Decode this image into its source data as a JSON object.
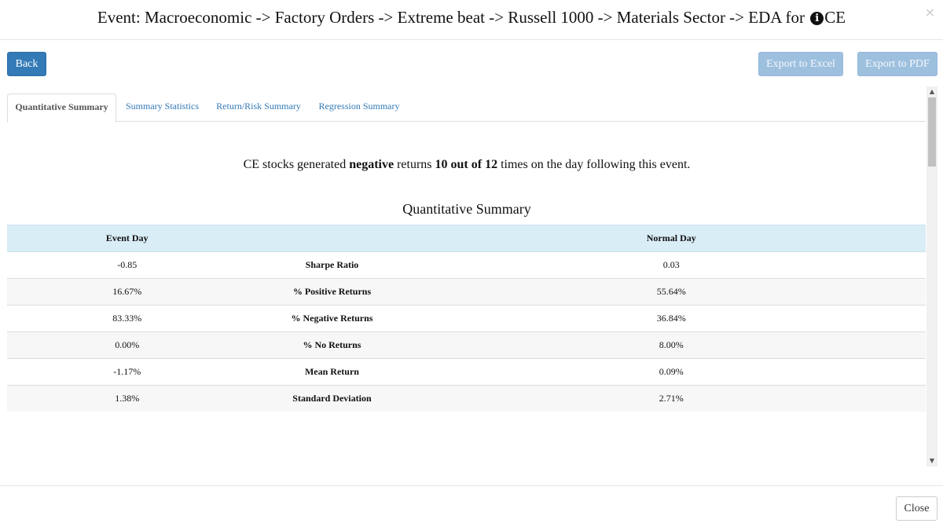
{
  "header": {
    "title_prefix": "Event: Macroeconomic -> Factory Orders -> Extreme beat -> Russell 1000 -> Materials Sector -> EDA for ",
    "info_icon": "info-circle-icon",
    "ticker": "CE",
    "close_glyph": "×"
  },
  "toolbar": {
    "back_label": "Back",
    "export_excel_label": "Export to Excel",
    "export_pdf_label": "Export to PDF"
  },
  "tabs": [
    {
      "label": "Quantitative Summary",
      "active": true
    },
    {
      "label": "Summary Statistics",
      "active": false
    },
    {
      "label": "Return/Risk Summary",
      "active": false
    },
    {
      "label": "Regression Summary",
      "active": false
    }
  ],
  "summary": {
    "part1": "CE stocks generated ",
    "direction": "negative",
    "part2": " returns ",
    "count": "10 out of 12",
    "part3": " times on the day following this event."
  },
  "table": {
    "title": "Quantitative Summary",
    "headers": [
      "Event Day",
      "",
      "Normal Day"
    ],
    "rows": [
      {
        "event": "-0.85",
        "metric": "Sharpe Ratio",
        "normal": "0.03"
      },
      {
        "event": "16.67%",
        "metric": "% Positive Returns",
        "normal": "55.64%"
      },
      {
        "event": "83.33%",
        "metric": "% Negative Returns",
        "normal": "36.84%"
      },
      {
        "event": "0.00%",
        "metric": "% No Returns",
        "normal": "8.00%"
      },
      {
        "event": "-1.17%",
        "metric": "Mean Return",
        "normal": "0.09%"
      },
      {
        "event": "1.38%",
        "metric": "Standard Deviation",
        "normal": "2.71%"
      }
    ]
  },
  "footer": {
    "close_label": "Close"
  },
  "colors": {
    "primary": "#337ab7",
    "primary_disabled": "#9ec0df",
    "table_header_bg": "#d9edf7"
  }
}
